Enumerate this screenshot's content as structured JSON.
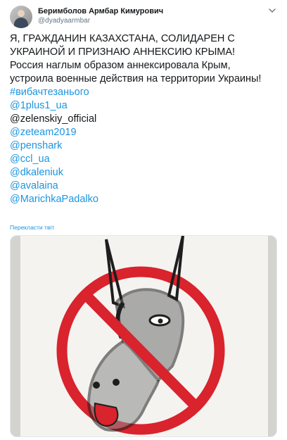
{
  "author": {
    "display_name": "Беримболов Армбар Кимурович",
    "handle": "@dyadyaarmbar",
    "avatar_icon": "user-avatar-icon"
  },
  "menu_icon": "chevron-down-icon",
  "tweet": {
    "lines": [
      "Я, ГРАЖДАНИН КАЗАХСТАНА, СОЛИДАРЕН  С",
      "УКРАИНОЙ И ПРИЗНАЮ АННЕКСИЮ КРЫМА!",
      "Россия наглым образом аннексировала Крым,",
      "устроила военные действия на территории Украины!"
    ],
    "hashtag": "#вибачтезанього",
    "mentions": [
      "@1plus1_ua",
      "@zelenskiy_official",
      "@zeteam2019",
      "@penshark",
      "@ccl_ua",
      "@dkaleniuk",
      "@avalaina",
      "@MarichkaPadalko"
    ],
    "translate_label": "Перекласти твіт"
  },
  "media": {
    "description_icon": "donkey-drawing-prohibition-sign",
    "colors": {
      "sign_red": "#d9232d",
      "paper": "#f4f3f0",
      "ink": "#1e1e1e",
      "background": "#d4d3cf"
    }
  },
  "colors": {
    "link": "#1b95e0",
    "text": "#14171a",
    "secondary": "#657786"
  }
}
